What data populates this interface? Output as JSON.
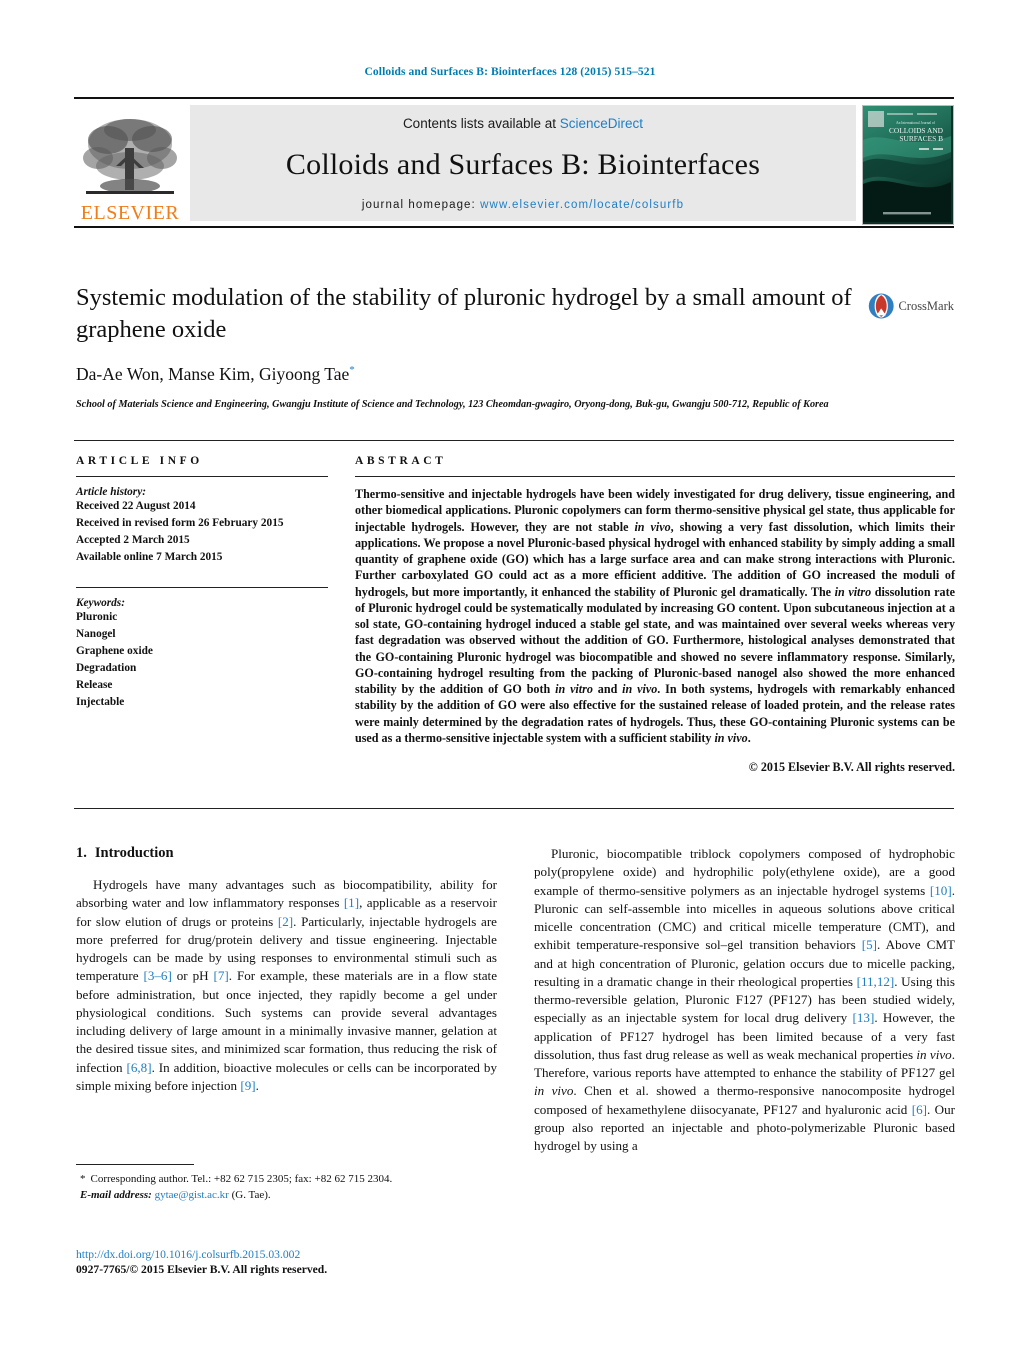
{
  "running_head": "Colloids and Surfaces B: Biointerfaces 128 (2015) 515–521",
  "masthead": {
    "publisher_name": "ELSEVIER",
    "contents_prefix": "Contents lists available at ",
    "contents_link": "ScienceDirect",
    "journal_title": "Colloids and Surfaces B: Biointerfaces",
    "homepage_label": "journal homepage:",
    "homepage_url": "www.elsevier.com/locate/colsurfb",
    "cover_journal_line1": "COLLOIDS AND",
    "cover_journal_line2": "SURFACES B",
    "cover_kicker": "An International Journal of"
  },
  "title_block": {
    "title": "Systemic modulation of the stability of pluronic hydrogel by a small amount of graphene oxide",
    "authors": "Da-Ae Won, Manse Kim, Giyoong Tae",
    "corresponding_marker": "*",
    "affiliation": "School of Materials Science and Engineering, Gwangju Institute of Science and Technology, 123 Cheomdan-gwagiro, Oryong-dong, Buk-gu, Gwangju 500-712, Republic of Korea",
    "crossmark_label": "CrossMark"
  },
  "article_info": {
    "heading": "ARTICLE INFO",
    "history_label": "Article history:",
    "history": [
      "Received 22 August 2014",
      "Received in revised form 26 February 2015",
      "Accepted 2 March 2015",
      "Available online 7 March 2015"
    ],
    "keywords_label": "Keywords:",
    "keywords": [
      "Pluronic",
      "Nanogel",
      "Graphene oxide",
      "Degradation",
      "Release",
      "Injectable"
    ]
  },
  "abstract": {
    "heading": "ABSTRACT",
    "paragraph_1": "Thermo-sensitive and injectable hydrogels have been widely investigated for drug delivery, tissue engineering, and other biomedical applications. Pluronic copolymers can form thermo-sensitive physical gel state, thus applicable for injectable hydrogels. However, they are not stable ",
    "italic_1": "in vivo",
    "paragraph_2": ", showing a very fast dissolution, which limits their applications. We propose a novel Pluronic-based physical hydrogel with enhanced stability by simply adding a small quantity of graphene oxide (GO) which has a large surface area and can make strong interactions with Pluronic. Further carboxylated GO could act as a more efficient additive. The addition of GO increased the moduli of hydrogels, but more importantly, it enhanced the stability of Pluronic gel dramatically. The ",
    "italic_2": "in vitro",
    "paragraph_3": " dissolution rate of Pluronic hydrogel could be systematically modulated by increasing GO content. Upon subcutaneous injection at a sol state, GO-containing hydrogel induced a stable gel state, and was maintained over several weeks whereas very fast degradation was observed without the addition of GO. Furthermore, histological analyses demonstrated that the GO-containing Pluronic hydrogel was biocompatible and showed no severe inflammatory response. Similarly, GO-containing hydrogel resulting from the packing of Pluronic-based nanogel also showed the more enhanced stability by the addition of GO both ",
    "italic_3": "in vitro",
    "paragraph_4": " and ",
    "italic_4": "in vivo",
    "paragraph_5": ". In both systems, hydrogels with remarkably enhanced stability by the addition of GO were also effective for the sustained release of loaded protein, and the release rates were mainly determined by the degradation rates of hydrogels. Thus, these GO-containing Pluronic systems can be used as a thermo-sensitive injectable system with a sufficient stability ",
    "italic_5": "in vivo",
    "paragraph_6": ".",
    "copyright": "© 2015 Elsevier B.V. All rights reserved."
  },
  "introduction": {
    "section_number": "1.",
    "section_title": "Introduction",
    "left_p1_a": "Hydrogels have many advantages such as biocompatibility, ability for absorbing water and low inflammatory responses ",
    "left_ref_1": "[1]",
    "left_p1_b": ", applicable as a reservoir for slow elution of drugs or proteins ",
    "left_ref_2": "[2]",
    "left_p1_c": ". Particularly, injectable hydrogels are more preferred for drug/protein delivery and tissue engineering. Injectable hydrogels can be made by using responses to environmental stimuli such as temperature ",
    "left_ref_3": "[3–6]",
    "left_p1_d": " or pH ",
    "left_ref_4": "[7]",
    "left_p1_e": ". For example, these materials are in a flow state before administration, but once injected, they rapidly become a gel under physiological conditions. Such systems can provide several advantages including delivery of large amount in a minimally invasive manner, gelation at the desired tissue sites, and minimized scar formation, thus reducing the risk of infection ",
    "left_ref_5": "[6,8]",
    "left_p1_f": ". In addition, bioactive molecules or cells can be incorporated by simple mixing before injection ",
    "left_ref_6": "[9]",
    "left_p1_g": ".",
    "right_p1_a": "Pluronic, biocompatible triblock copolymers composed of hydrophobic poly(propylene oxide) and hydrophilic poly(ethylene oxide), are a good example of thermo-sensitive polymers as an injectable hydrogel systems ",
    "right_ref_1": "[10]",
    "right_p1_b": ". Pluronic can self-assemble into micelles in aqueous solutions above critical micelle concentration (CMC) and critical micelle temperature (CMT), and exhibit temperature-responsive sol–gel transition behaviors ",
    "right_ref_2": "[5]",
    "right_p1_c": ". Above CMT and at high concentration of Pluronic, gelation occurs due to micelle packing, resulting in a dramatic change in their rheological properties ",
    "right_ref_3": "[11,12]",
    "right_p1_d": ". Using this thermo-reversible gelation, Pluronic F127 (PF127) has been studied widely, especially as an injectable system for local drug delivery ",
    "right_ref_4": "[13]",
    "right_p1_e": ". However, the application of PF127 hydrogel has been limited because of a very fast dissolution, thus fast drug release as well as weak mechanical properties ",
    "right_italic_1": "in vivo",
    "right_p1_f": ". Therefore, various reports have attempted to enhance the stability of PF127 gel ",
    "right_italic_2": "in vivo",
    "right_p1_g": ". Chen et al. showed a thermo-responsive nanocomposite hydrogel composed of hexamethylene diisocyanate, PF127 and hyaluronic acid ",
    "right_ref_5": "[6]",
    "right_p1_h": ". Our group also reported an injectable and photo-polymerizable Pluronic based hydrogel by using a"
  },
  "footer": {
    "corresponding_star": "*",
    "corresponding_text": "Corresponding author. Tel.: +82 62 715 2305; fax: +82 62 715 2304.",
    "email_label": "E-mail address:",
    "email": "gytae@gist.ac.kr",
    "email_suffix": "(G. Tae).",
    "doi_url": "http://dx.doi.org/10.1016/j.colsurfb.2015.03.002",
    "issn_line": "0927-7765/© 2015 Elsevier B.V. All rights reserved."
  },
  "colors": {
    "link_blue": "#1f7ec4",
    "running_head_blue": "#007cb0",
    "elsevier_orange": "#ef7d1a",
    "band_gray": "#e8e8e8"
  }
}
